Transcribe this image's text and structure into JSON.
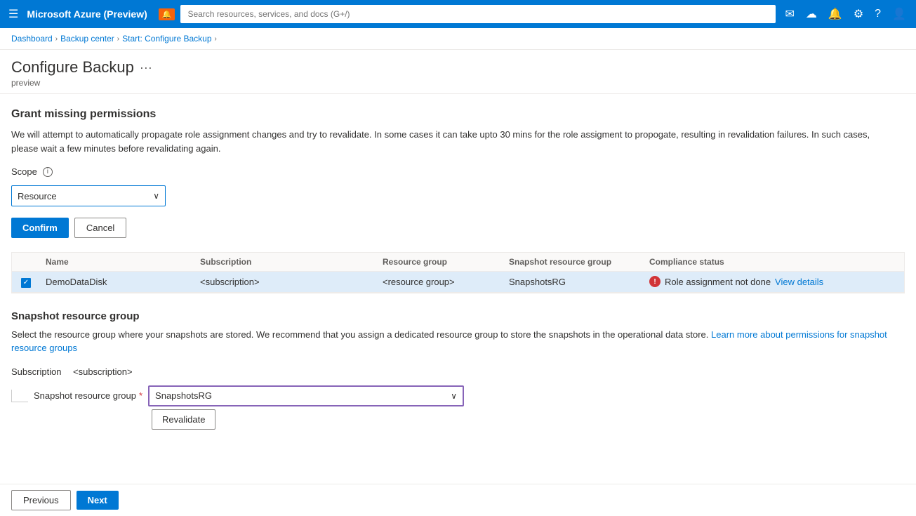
{
  "topnav": {
    "title": "Microsoft Azure (Preview)",
    "badge": "🔔",
    "search_placeholder": "Search resources, services, and docs (G+/)"
  },
  "breadcrumb": {
    "items": [
      "Dashboard",
      "Backup center",
      "Start: Configure Backup"
    ]
  },
  "page": {
    "title": "Configure Backup",
    "menu_icon": "···",
    "subtitle": "preview"
  },
  "grant_section": {
    "title": "Grant missing permissions",
    "description": "We will attempt to automatically propagate role assignment changes and try to revalidate. In some cases it can take upto 30 mins for the role assigment to propogate, resulting in revalidation failures. In such cases, please wait a few minutes before revalidating again.",
    "scope_label": "Scope",
    "scope_value": "Resource",
    "confirm_button": "Confirm",
    "cancel_button": "Cancel"
  },
  "table": {
    "headers": [
      "",
      "Name",
      "Subscription",
      "",
      "Resource group",
      "Snapshot resource group",
      "Compliance status"
    ],
    "row": {
      "checked": true,
      "name": "DemoDataDisk",
      "subscription": "<subscription>",
      "blank": "",
      "resource_group": "<resource group>",
      "snapshot_rg": "SnapshotsRG",
      "status": "Role assignment not done",
      "view_details_link": "View details"
    }
  },
  "snapshot_section": {
    "title": "Snapshot resource group",
    "description_part1": "Select the resource group where your snapshots are stored. We recommend that you assign a dedicated resource group to store the snapshots in the operational data store.",
    "learn_more_link": "Learn more about permissions for snapshot resource groups",
    "subscription_label": "Subscription",
    "subscription_value": "<subscription>",
    "rg_label": "Snapshot resource group",
    "rg_required": "*",
    "rg_value": "SnapshotsRG",
    "revalidate_button": "Revalidate"
  },
  "footer": {
    "previous_button": "Previous",
    "next_button": "Next"
  }
}
